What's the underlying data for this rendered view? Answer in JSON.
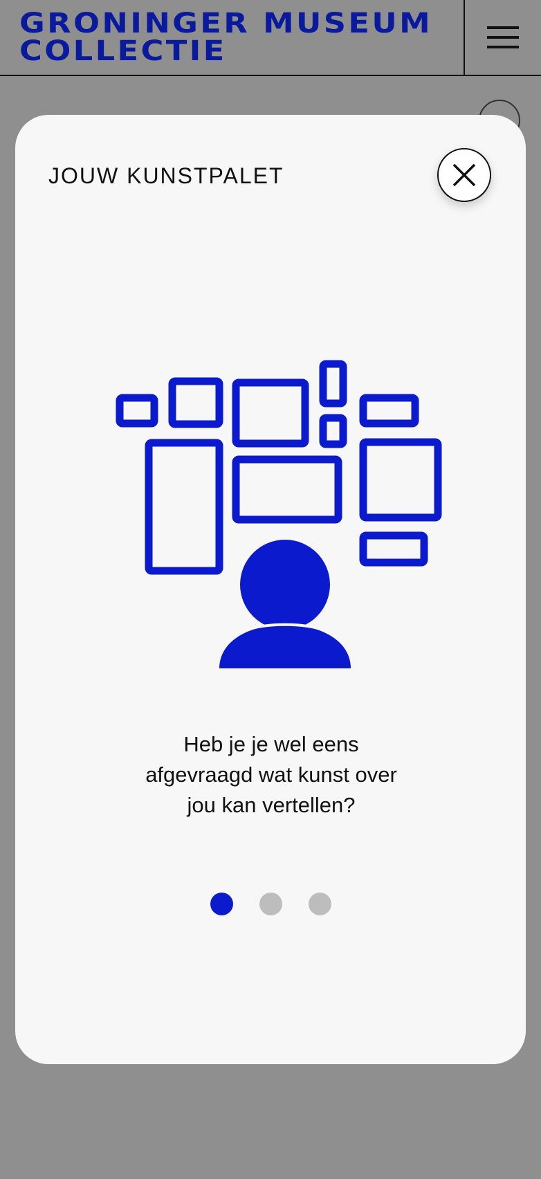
{
  "header": {
    "logo_line1": "GRONINGER MUSEUM",
    "logo_line2": "COLLECTIE",
    "menu_icon": "hamburger-menu-icon"
  },
  "modal": {
    "title": "JOUW KUNSTPALET",
    "close_icon": "close-icon",
    "illustration": "person-viewing-gallery-wall-icon",
    "message_line1": "Heb je je wel eens",
    "message_line2": "afgevraagd wat kunst over",
    "message_line3": "jou kan vertellen?",
    "pagination": {
      "total": 3,
      "current": 1
    }
  },
  "colors": {
    "brand_blue": "#0a1a9c",
    "accent_blue": "#0a1acc",
    "overlay": "#8f8f8f",
    "modal_bg": "#f7f7f7",
    "dot_inactive": "#bdbdbd"
  }
}
